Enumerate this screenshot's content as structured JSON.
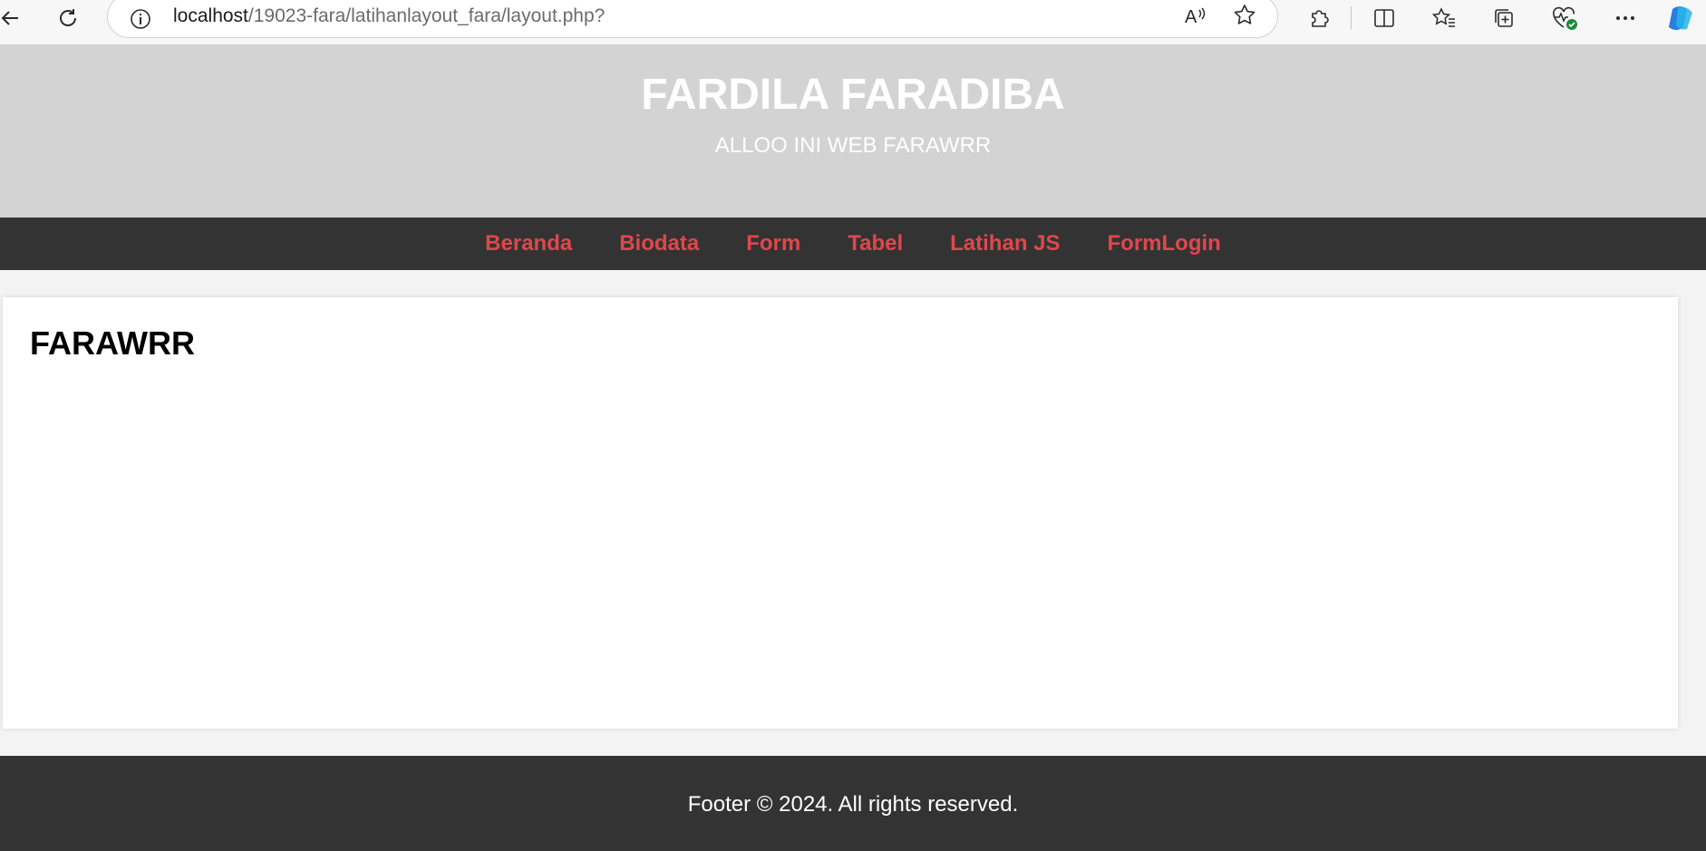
{
  "browser": {
    "url_host": "localhost",
    "url_path": "/19023-fara/latihanlayout_fara/layout.php?"
  },
  "header": {
    "title": "FARDILA FARADIBA",
    "subtitle": "ALLOO INI WEB FARAWRR"
  },
  "nav": {
    "items": [
      {
        "label": "Beranda"
      },
      {
        "label": "Biodata"
      },
      {
        "label": "Form"
      },
      {
        "label": "Tabel"
      },
      {
        "label": "Latihan JS"
      },
      {
        "label": "FormLogin"
      }
    ]
  },
  "main": {
    "heading": "FARAWRR"
  },
  "footer": {
    "text": "Footer © 2024. All rights reserved."
  },
  "colors": {
    "header_bg": "#d3d3d3",
    "nav_bg": "#333333",
    "nav_link": "#e0474c",
    "footer_bg": "#333333"
  }
}
